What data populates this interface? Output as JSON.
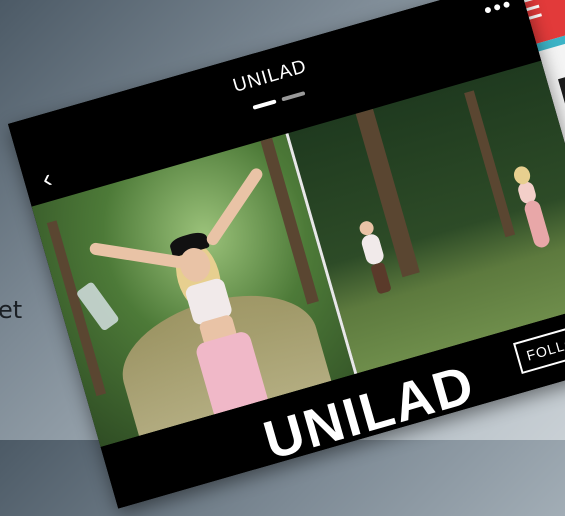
{
  "background": {
    "partial_text": "et"
  },
  "post": {
    "title": "UNILAD",
    "menu_icon": "more-dots-icon",
    "back_icon": "chevron-left-icon",
    "pager": {
      "count": 2,
      "active": 1
    },
    "brand": "UNILAD",
    "follow_label": "FOLLOW"
  },
  "colors": {
    "back_topbar": "#e23a3a",
    "accent_stripe": "#3cb3c6"
  }
}
